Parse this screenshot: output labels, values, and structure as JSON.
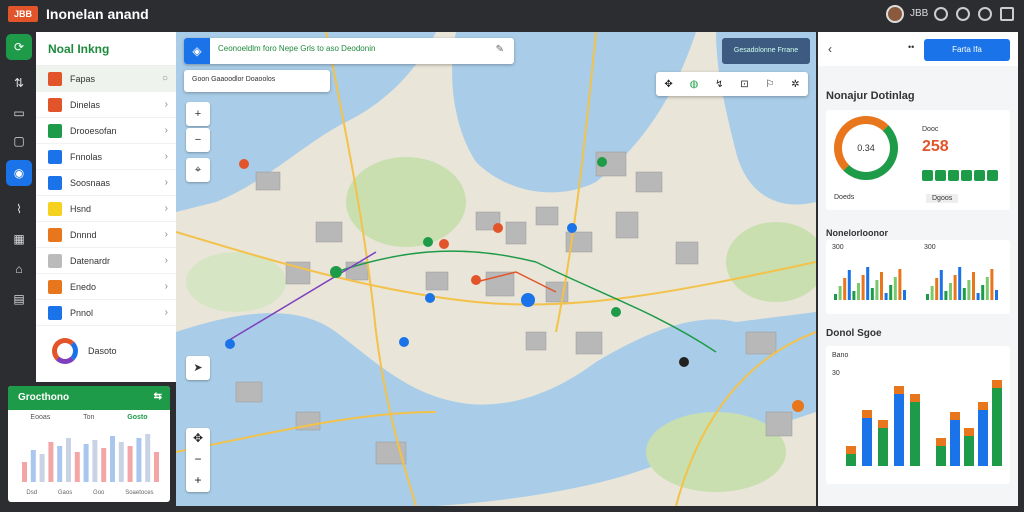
{
  "app": {
    "logo_text": "JBB",
    "title": "Inonelan anand"
  },
  "topbar": {
    "user_text": "JBB"
  },
  "sidebar": {
    "header": "Noal Inkng",
    "items": [
      {
        "label": "Fapas",
        "color": "#e2552a",
        "active": true
      },
      {
        "label": "Dinelas",
        "color": "#e2552a"
      },
      {
        "label": "Drooesofan",
        "color": "#1e9b48"
      },
      {
        "label": "Fnnolas",
        "color": "#1a73e8"
      },
      {
        "label": "Soosnaas",
        "color": "#1a73e8"
      },
      {
        "label": "Hsnd",
        "color": "#f4d21f"
      },
      {
        "label": "Dnnnd",
        "color": "#e8761c"
      },
      {
        "label": "Datenardr",
        "color": "#bbbbbb"
      },
      {
        "label": "Enedo",
        "color": "#e8761c"
      },
      {
        "label": "Pnnol",
        "color": "#1a73e8"
      }
    ],
    "footer_label": "Dasoto"
  },
  "widget_bl": {
    "title": "Grocthono",
    "labels": [
      "Eooas",
      "Ton",
      "Gosto"
    ],
    "axis": [
      "Dsd",
      "Gaos",
      "Goo",
      "Soaetoces"
    ],
    "values": [
      20,
      32,
      28,
      40,
      36,
      44,
      30,
      38,
      42,
      34,
      46,
      40,
      36,
      44,
      48,
      30
    ]
  },
  "map": {
    "search_value": "Ceonoeldlm foro Nepe Grls to aso Deodonin",
    "sub_search": "Goon Gaaoodlor Doaoolos",
    "top_right_label": "Gesadolonne Frrane",
    "toolbar_icons": [
      "move-icon",
      "layers-icon",
      "route-icon",
      "lock-icon",
      "pin-icon",
      "settings-icon"
    ]
  },
  "right_panel": {
    "share_label": "Farta Ifa",
    "section_title": "Nonajur Dotinlag",
    "big_value": "258",
    "big_value_sub": "Dooc",
    "donut_label": "0.34",
    "legend_label": "Doeds",
    "legend_tag": "Dgoos",
    "card2_title": "Nonelorloonor",
    "card2_scale": "300",
    "section2_title": "Donol Sgoe",
    "card3_title": "Bano",
    "card3_scale": "30",
    "bar_series_a": [
      12,
      48,
      38,
      72,
      64
    ],
    "bar_series_b": [
      20,
      46,
      30,
      56,
      78
    ]
  },
  "colors": {
    "green": "#1e9b48",
    "orange": "#e8761c",
    "blue": "#1a73e8",
    "red": "#e2552a"
  }
}
